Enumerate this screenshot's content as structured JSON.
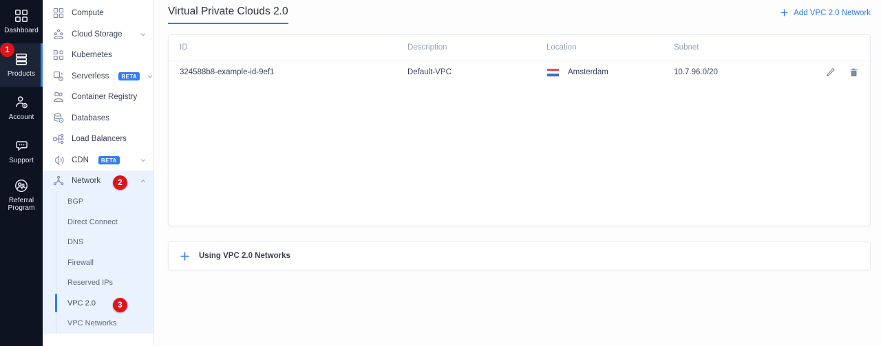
{
  "rail": {
    "items": [
      {
        "label": "Dashboard",
        "icon": "grid-icon",
        "active": false
      },
      {
        "label": "Products",
        "icon": "layers-icon",
        "active": true
      },
      {
        "label": "Account",
        "icon": "account-icon",
        "active": false
      },
      {
        "label": "Support",
        "icon": "chat-icon",
        "active": false
      },
      {
        "label": "Referral\nProgram",
        "icon": "people-icon",
        "active": false
      }
    ]
  },
  "sidebar": {
    "items": [
      {
        "label": "Compute",
        "icon": "compute-icon",
        "badge": null,
        "chevron": null,
        "expanded": false
      },
      {
        "label": "Cloud Storage",
        "icon": "storage-icon",
        "badge": null,
        "chevron": "down",
        "expanded": false
      },
      {
        "label": "Kubernetes",
        "icon": "kubernetes-icon",
        "badge": null,
        "chevron": null,
        "expanded": false
      },
      {
        "label": "Serverless",
        "icon": "serverless-icon",
        "badge": "BETA",
        "chevron": "down",
        "expanded": false
      },
      {
        "label": "Container Registry",
        "icon": "registry-icon",
        "badge": null,
        "chevron": null,
        "expanded": false
      },
      {
        "label": "Databases",
        "icon": "database-icon",
        "badge": null,
        "chevron": null,
        "expanded": false
      },
      {
        "label": "Load Balancers",
        "icon": "balancer-icon",
        "badge": null,
        "chevron": null,
        "expanded": false
      },
      {
        "label": "CDN",
        "icon": "cdn-icon",
        "badge": "BETA",
        "chevron": "down",
        "expanded": false
      },
      {
        "label": "Network",
        "icon": "network-icon",
        "badge": null,
        "chevron": "up",
        "expanded": true
      }
    ],
    "network_children": [
      {
        "label": "BGP",
        "active": false
      },
      {
        "label": "Direct Connect",
        "active": false
      },
      {
        "label": "DNS",
        "active": false
      },
      {
        "label": "Firewall",
        "active": false
      },
      {
        "label": "Reserved IPs",
        "active": false
      },
      {
        "label": "VPC 2.0",
        "active": true
      },
      {
        "label": "VPC Networks",
        "active": false
      }
    ]
  },
  "step_badges": [
    {
      "id": "badge1",
      "number": "1"
    },
    {
      "id": "badge2",
      "number": "2"
    },
    {
      "id": "badge3",
      "number": "3"
    }
  ],
  "main": {
    "page_title": "Virtual Private Clouds 2.0",
    "add_link": {
      "label": "Add VPC 2.0 Network",
      "icon": "plus-icon"
    },
    "table": {
      "columns": [
        "ID",
        "Description",
        "Location",
        "Subnet",
        ""
      ],
      "rows": [
        {
          "id": "324588b8-example-id-9ef1",
          "description": "Default-VPC",
          "location": "Amsterdam",
          "flag": "netherlands-flag",
          "subnet": "10.7.96.0/20",
          "edit_icon": "pencil-icon",
          "delete_icon": "trash-icon"
        }
      ]
    },
    "accordion": {
      "label": "Using VPC 2.0 Networks",
      "icon": "plus-icon"
    }
  },
  "colors": {
    "accent": "#2f7cf6",
    "badge": "#e1121b",
    "rail_bg": "#0d1321",
    "rail_active": "#1c2538",
    "nav_expanded_bg": "#eaf2fd",
    "flag_red": "#ef4a55",
    "flag_white": "#ffffff",
    "flag_blue": "#3d6cc8"
  }
}
